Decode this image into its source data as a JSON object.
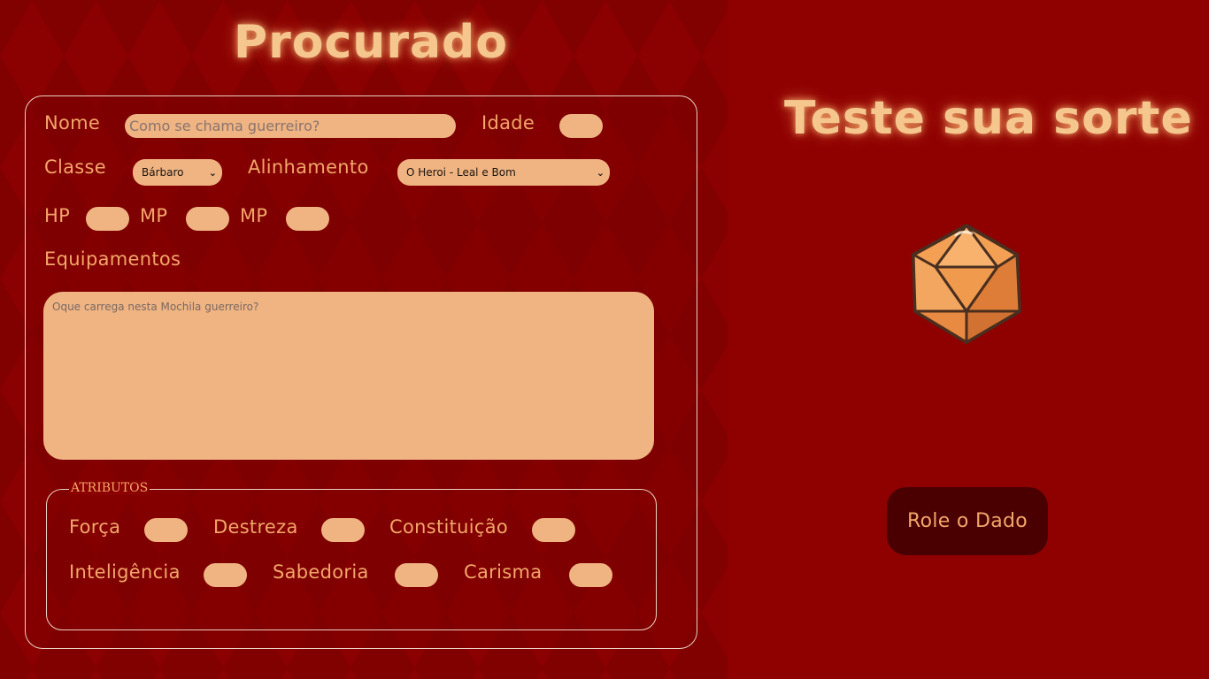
{
  "sheet": {
    "title": "Procurado",
    "name_label": "Nome",
    "name_placeholder": "Como se chama guerreiro?",
    "age_label": "Idade",
    "class_label": "Classe",
    "class_value": "Bárbaro",
    "alignment_label": "Alinhamento",
    "alignment_value": "O Heroi - Leal e Bom",
    "hp_label": "HP",
    "mp_label_1": "MP",
    "mp_label_2": "MP",
    "equipment_label": "Equipamentos",
    "equipment_placeholder": "Oque carrega nesta Mochila guerreiro?",
    "attributes": {
      "legend": "ATRIBUTOS",
      "strength": "Força",
      "dexterity": "Destreza",
      "constitution": "Constituição",
      "intelligence": "Inteligência",
      "wisdom": "Sabedoria",
      "charisma": "Carisma"
    }
  },
  "dice": {
    "title": "Teste sua sorte",
    "die_icon": "d20-icon",
    "roll_button": "Role o Dado"
  },
  "colors": {
    "background": "#8b0000",
    "accent_text": "#f2a66a",
    "field_fill": "#efb482",
    "glow_title": "#f5c78e",
    "button_bg": "#4a0000"
  }
}
